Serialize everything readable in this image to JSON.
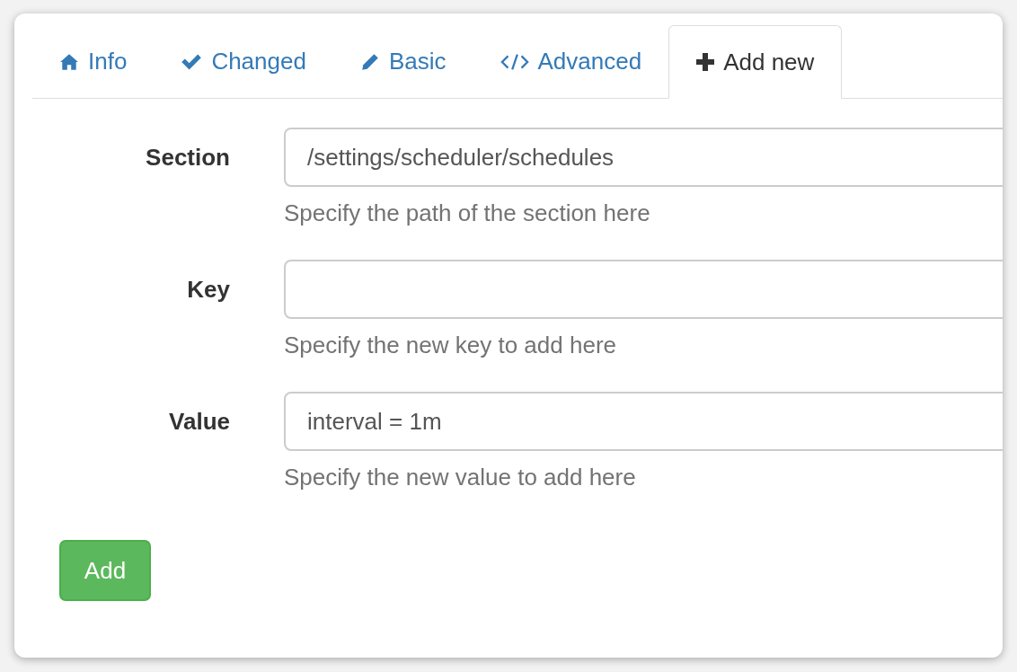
{
  "tabs": [
    {
      "label": "Info",
      "kind": "home",
      "selected": false
    },
    {
      "label": "Changed",
      "kind": "check",
      "selected": false
    },
    {
      "label": "Basic",
      "kind": "pencil",
      "selected": false
    },
    {
      "label": "Advanced",
      "kind": "code",
      "selected": false
    },
    {
      "label": "Add new",
      "kind": "plus",
      "selected": true
    }
  ],
  "form": {
    "fields": [
      {
        "label": "Section",
        "value": "/settings/scheduler/schedules",
        "help": "Specify the path of the section here"
      },
      {
        "label": "Key",
        "help": "Specify the new key to add here"
      },
      {
        "label": "Value",
        "value": "interval = 1m",
        "help": "Specify the new value to add here"
      }
    ]
  },
  "buttons": [
    {
      "label": "Add"
    }
  ]
}
